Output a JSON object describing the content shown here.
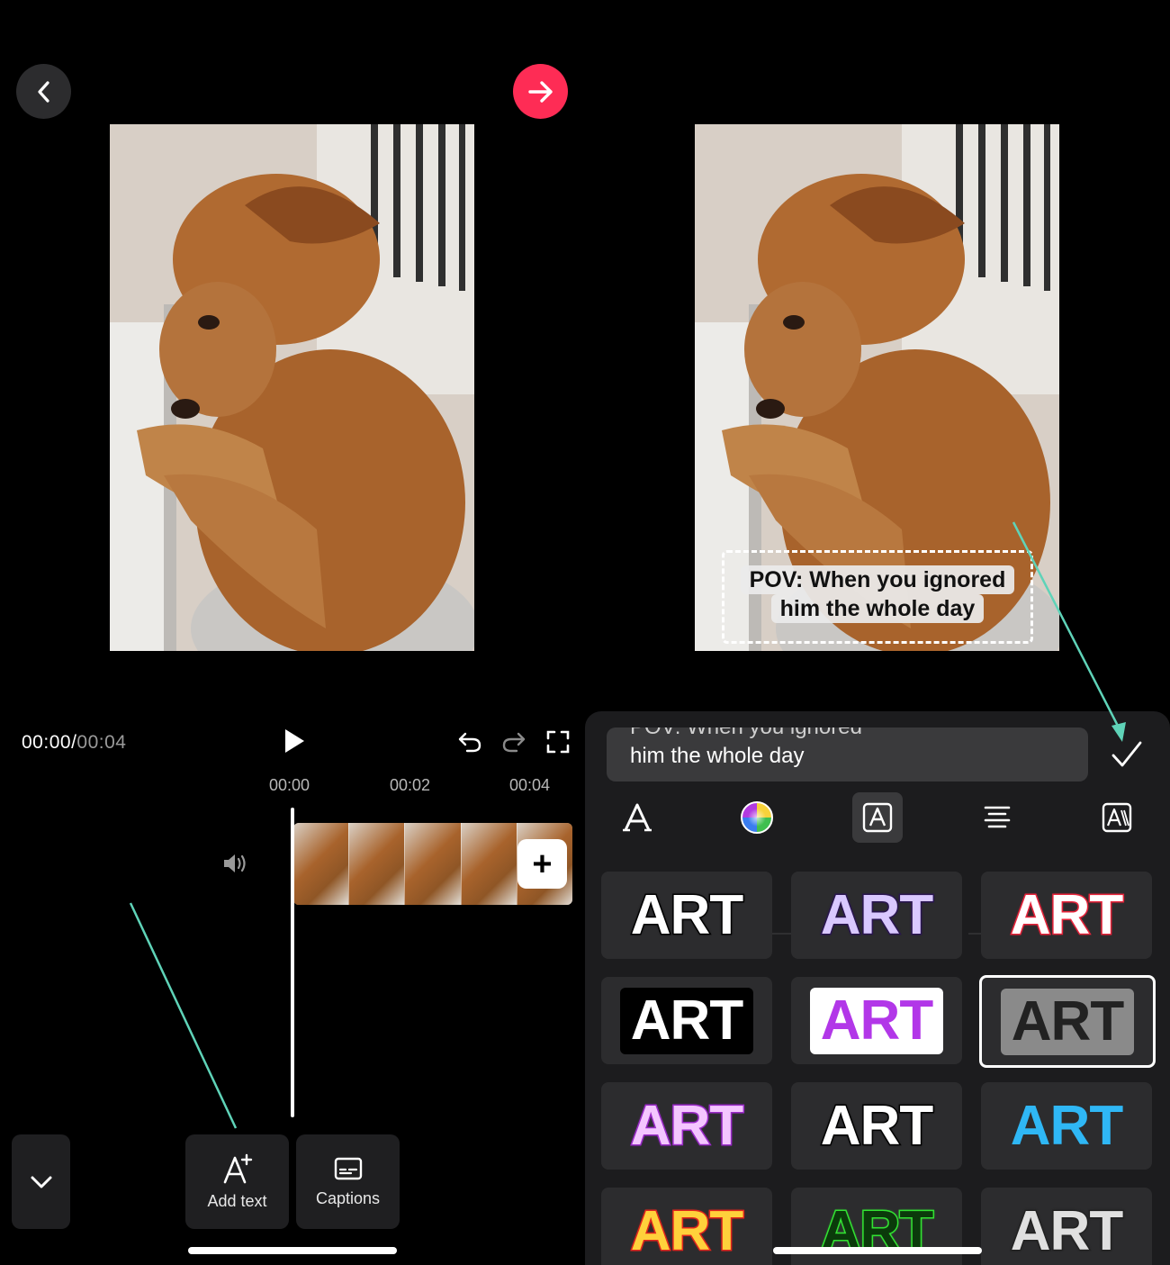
{
  "editor": {
    "time_current": "00:00",
    "time_separator": "/",
    "time_total": "00:04",
    "ticks": [
      "00:00",
      "00:02",
      "00:04"
    ],
    "add_clip_label": "+",
    "tools": {
      "add_text_label": "Add text",
      "captions_label": "Captions"
    }
  },
  "caption_overlay": {
    "line1": "POV: When you ignored",
    "line2": "him the whole day"
  },
  "text_panel": {
    "input_line1": "POV: When you ignored",
    "input_line2": "him the whole day",
    "tabs": [
      {
        "icon": "font-icon"
      },
      {
        "icon": "color-wheel-icon"
      },
      {
        "icon": "text-style-icon"
      },
      {
        "icon": "align-center-icon"
      },
      {
        "icon": "text-animation-icon"
      }
    ],
    "styles": [
      {
        "label": "ART",
        "color": "#ffffff",
        "stroke": "#000000",
        "bg": "none"
      },
      {
        "label": "ART",
        "color": "#d9c8ff",
        "stroke": "#2a1650",
        "bg": "none"
      },
      {
        "label": "ART",
        "color": "#ffffff",
        "stroke": "#e8243b",
        "bg": "none"
      },
      {
        "label": "ART",
        "color": "#ffffff",
        "stroke": "#000000",
        "bg": "#000000"
      },
      {
        "label": "ART",
        "color": "#b237e8",
        "stroke": "none",
        "bg": "#ffffff"
      },
      {
        "label": "ART",
        "color": "#222222",
        "stroke": "none",
        "bg": "#8a8a8a"
      },
      {
        "label": "ART",
        "color": "#f4c6ff",
        "stroke": "#9b2bc9",
        "bg": "none"
      },
      {
        "label": "ART",
        "color": "#ffffff",
        "stroke": "#000000",
        "bg": "none"
      },
      {
        "label": "ART",
        "color": "#2fb7f5",
        "stroke": "none",
        "bg": "none"
      },
      {
        "label": "ART",
        "color": "#ffd13b",
        "stroke": "#e2261d",
        "bg": "none"
      },
      {
        "label": "ART",
        "color": "#0b3a0b",
        "stroke": "#33e233",
        "bg": "none"
      },
      {
        "label": "ART",
        "color": "#e0e0e0",
        "stroke": "#222222",
        "bg": "none"
      }
    ],
    "selected_style_index": 5
  },
  "colors": {
    "accent": "#fe2c55",
    "annotation": "#5fd3b8",
    "panel_bg": "#1c1c1e",
    "cell_bg": "#2c2c2e"
  }
}
